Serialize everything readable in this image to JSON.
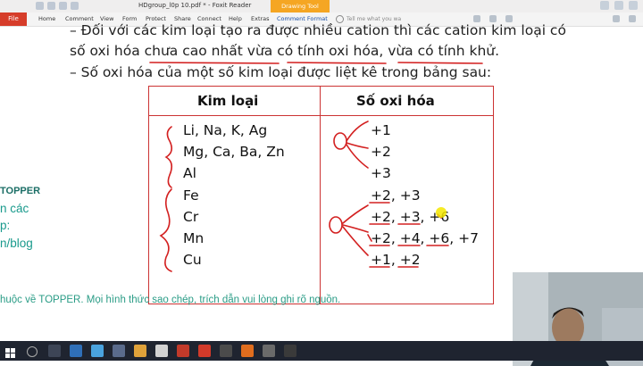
{
  "app": {
    "window_title": "HDgroup_l0p 10.pdf * - Foxit Reader",
    "context_tab": "Drawing Tool",
    "file_label": "File",
    "menus": [
      "Home",
      "Comment",
      "View",
      "Form",
      "Protect",
      "Share",
      "Connect",
      "Help",
      "Extras",
      "Comment Format"
    ],
    "search_placeholder": "Tell me what you wa",
    "accent_color": "#d63d2a",
    "context_tab_color": "#f5a623"
  },
  "document": {
    "lines": [
      "– Đối với các kim loại tạo ra được nhiều cation thì các cation kim loại có",
      "số oxi hóa chưa cao nhất vừa có tính oxi hóa, vừa có tính khử.",
      "– Số oxi hóa của một số kim loại được liệt kê trong bảng sau:"
    ],
    "side_text": [
      "TOPPER",
      "n các",
      "p:",
      "n/blog"
    ],
    "footer": "huộc về TOPPER. Mọi hình thức sao chép, trích dẫn vui lòng ghi rõ nguồn.",
    "table": {
      "headers": [
        "Kim loại",
        "Số oxi hóa"
      ],
      "rows": [
        {
          "metal": "Li, Na, K, Ag",
          "ox": "+1"
        },
        {
          "metal": "Mg, Ca, Ba, Zn",
          "ox": "+2"
        },
        {
          "metal": "Al",
          "ox": "+3"
        },
        {
          "metal": "Fe",
          "ox": "+2, +3"
        },
        {
          "metal": "Cr",
          "ox": "+2, +3, +6"
        },
        {
          "metal": "Mn",
          "ox": "+2, +4, +6, +7"
        },
        {
          "metal": "Cu",
          "ox": "+1, +2"
        }
      ]
    },
    "annotation_color": "#d32020",
    "highlight_color": "#f5e800"
  },
  "taskbar": {
    "time": "",
    "icons": [
      "start-icon",
      "search-icon",
      "task-view-icon",
      "folder-icon",
      "edge-icon",
      "store-icon",
      "chrome-icon",
      "foxit-icon",
      "settings-icon",
      "camera-icon"
    ]
  }
}
